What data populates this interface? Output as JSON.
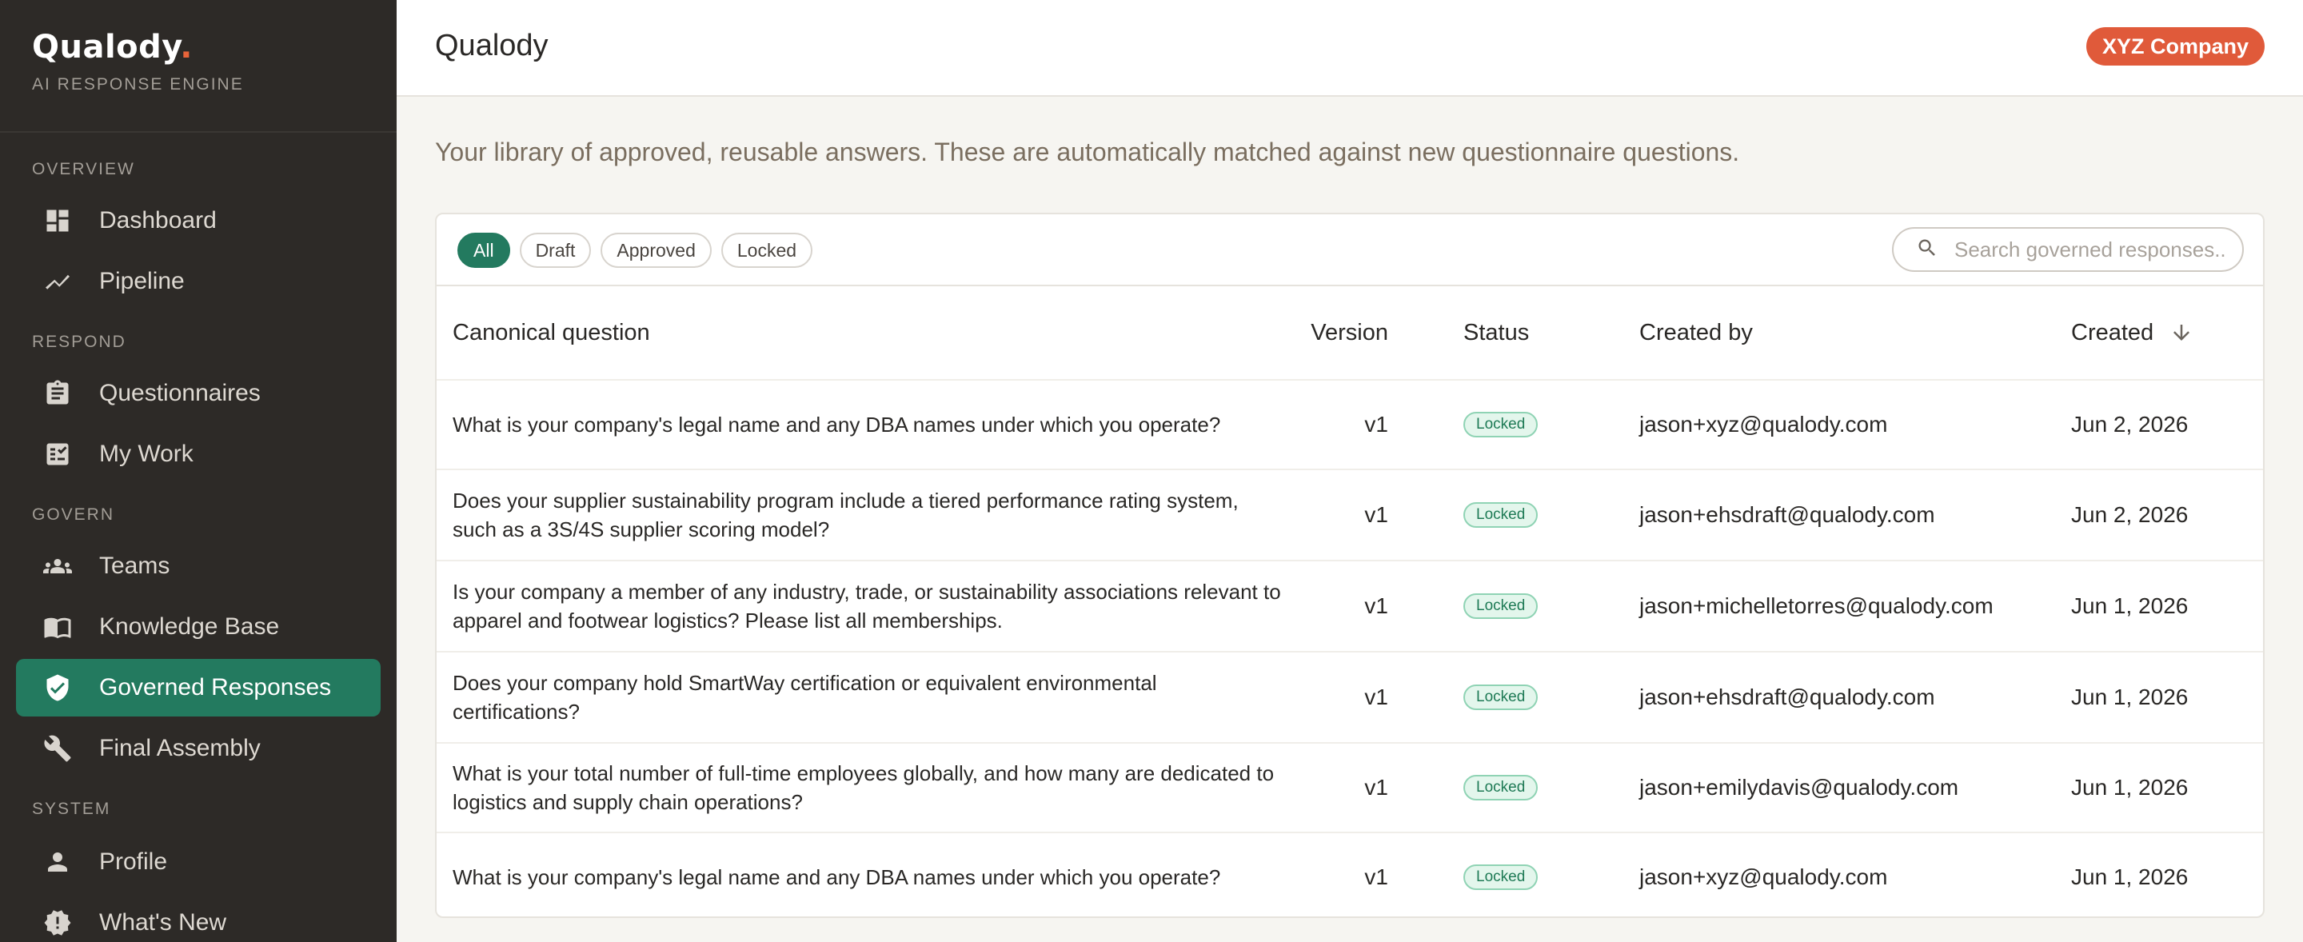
{
  "brand": {
    "name": "Qualody",
    "dot": ".",
    "tagline": "AI RESPONSE ENGINE"
  },
  "sidebar": {
    "sections": [
      "OVERVIEW",
      "RESPOND",
      "GOVERN",
      "SYSTEM"
    ],
    "items": [
      {
        "label": "Dashboard",
        "icon": "dashboard-icon"
      },
      {
        "label": "Pipeline",
        "icon": "pipeline-icon"
      },
      {
        "label": "Questionnaires",
        "icon": "clipboard-icon"
      },
      {
        "label": "My Work",
        "icon": "checklist-icon"
      },
      {
        "label": "Teams",
        "icon": "people-icon"
      },
      {
        "label": "Knowledge Base",
        "icon": "book-icon"
      },
      {
        "label": "Governed Responses",
        "icon": "shield-check-icon",
        "active": true
      },
      {
        "label": "Final Assembly",
        "icon": "wrench-icon"
      },
      {
        "label": "Profile",
        "icon": "person-icon"
      },
      {
        "label": "What's New",
        "icon": "badge-icon"
      }
    ]
  },
  "header": {
    "title": "Qualody",
    "company": "XYZ Company"
  },
  "intro": "Your library of approved, reusable answers. These are automatically matched against new questionnaire questions.",
  "filters": [
    "All",
    "Draft",
    "Approved",
    "Locked"
  ],
  "search": {
    "placeholder": "Search governed responses.."
  },
  "table": {
    "columns": [
      "Canonical question",
      "Version",
      "Status",
      "Created by",
      "Created"
    ],
    "rows": [
      {
        "question": "What is your company's legal name and any DBA names under which you operate?",
        "version": "v1",
        "status": "Locked",
        "created_by": "jason+xyz@qualody.com",
        "created": "Jun 2, 2026"
      },
      {
        "question": "Does your supplier sustainability program include a tiered performance rating system, such as a 3S/4S supplier scoring model?",
        "version": "v1",
        "status": "Locked",
        "created_by": "jason+ehsdraft@qualody.com",
        "created": "Jun 2, 2026"
      },
      {
        "question": "Is your company a member of any industry, trade, or sustainability associations relevant to apparel and footwear logistics? Please list all memberships.",
        "version": "v1",
        "status": "Locked",
        "created_by": "jason+michelletorres@qualody.com",
        "created": "Jun 1, 2026"
      },
      {
        "question": "Does your company hold SmartWay certification or equivalent environmental certifications?",
        "version": "v1",
        "status": "Locked",
        "created_by": "jason+ehsdraft@qualody.com",
        "created": "Jun 1, 2026"
      },
      {
        "question": "What is your total number of full-time employees globally, and how many are dedicated to logistics and supply chain operations?",
        "version": "v1",
        "status": "Locked",
        "created_by": "jason+emilydavis@qualody.com",
        "created": "Jun 1, 2026"
      },
      {
        "question": "What is your company's legal name and any DBA names under which you operate?",
        "version": "v1",
        "status": "Locked",
        "created_by": "jason+xyz@qualody.com",
        "created": "Jun 1, 2026"
      }
    ]
  },
  "colors": {
    "sidebar_bg": "#2d2a27",
    "accent_green": "#237a5f",
    "brand_orange": "#e05a3a",
    "page_bg": "#f6f5f1"
  }
}
